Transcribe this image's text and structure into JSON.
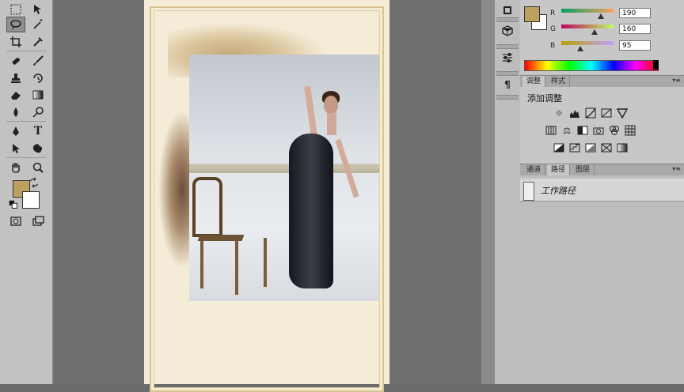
{
  "colors": {
    "foreground": "#be9f5f",
    "background": "#ffffff",
    "accent": "#be9f5f"
  },
  "tools": [
    {
      "name": "marquee-tool-icon"
    },
    {
      "name": "move-tool-icon"
    },
    {
      "name": "lasso-tool-icon"
    },
    {
      "name": "magic-wand-tool-icon"
    },
    {
      "name": "crop-tool-icon"
    },
    {
      "name": "eyedropper-tool-icon"
    },
    {
      "name": "healing-brush-tool-icon"
    },
    {
      "name": "brush-tool-icon"
    },
    {
      "name": "clone-stamp-tool-icon"
    },
    {
      "name": "history-brush-tool-icon"
    },
    {
      "name": "eraser-tool-icon"
    },
    {
      "name": "gradient-tool-icon"
    },
    {
      "name": "blur-tool-icon"
    },
    {
      "name": "dodge-tool-icon"
    },
    {
      "name": "pen-tool-icon"
    },
    {
      "name": "type-tool-icon"
    },
    {
      "name": "path-selection-tool-icon"
    },
    {
      "name": "shape-tool-icon"
    },
    {
      "name": "hand-tool-icon"
    },
    {
      "name": "zoom-tool-icon"
    }
  ],
  "type_tool_glyph": "T",
  "color_panel": {
    "r_label": "R",
    "r_value": "190",
    "g_label": "G",
    "g_value": "160",
    "b_label": "B",
    "b_value": "95"
  },
  "adjustments_panel": {
    "tab_adjustments": "调整",
    "tab_styles": "样式",
    "title": "添加调整"
  },
  "paths_panel": {
    "tab_channels": "通道",
    "tab_paths": "路径",
    "tab_layers": "图层",
    "item_name": "工作路径"
  },
  "strip_glyph_paragraph": "¶"
}
